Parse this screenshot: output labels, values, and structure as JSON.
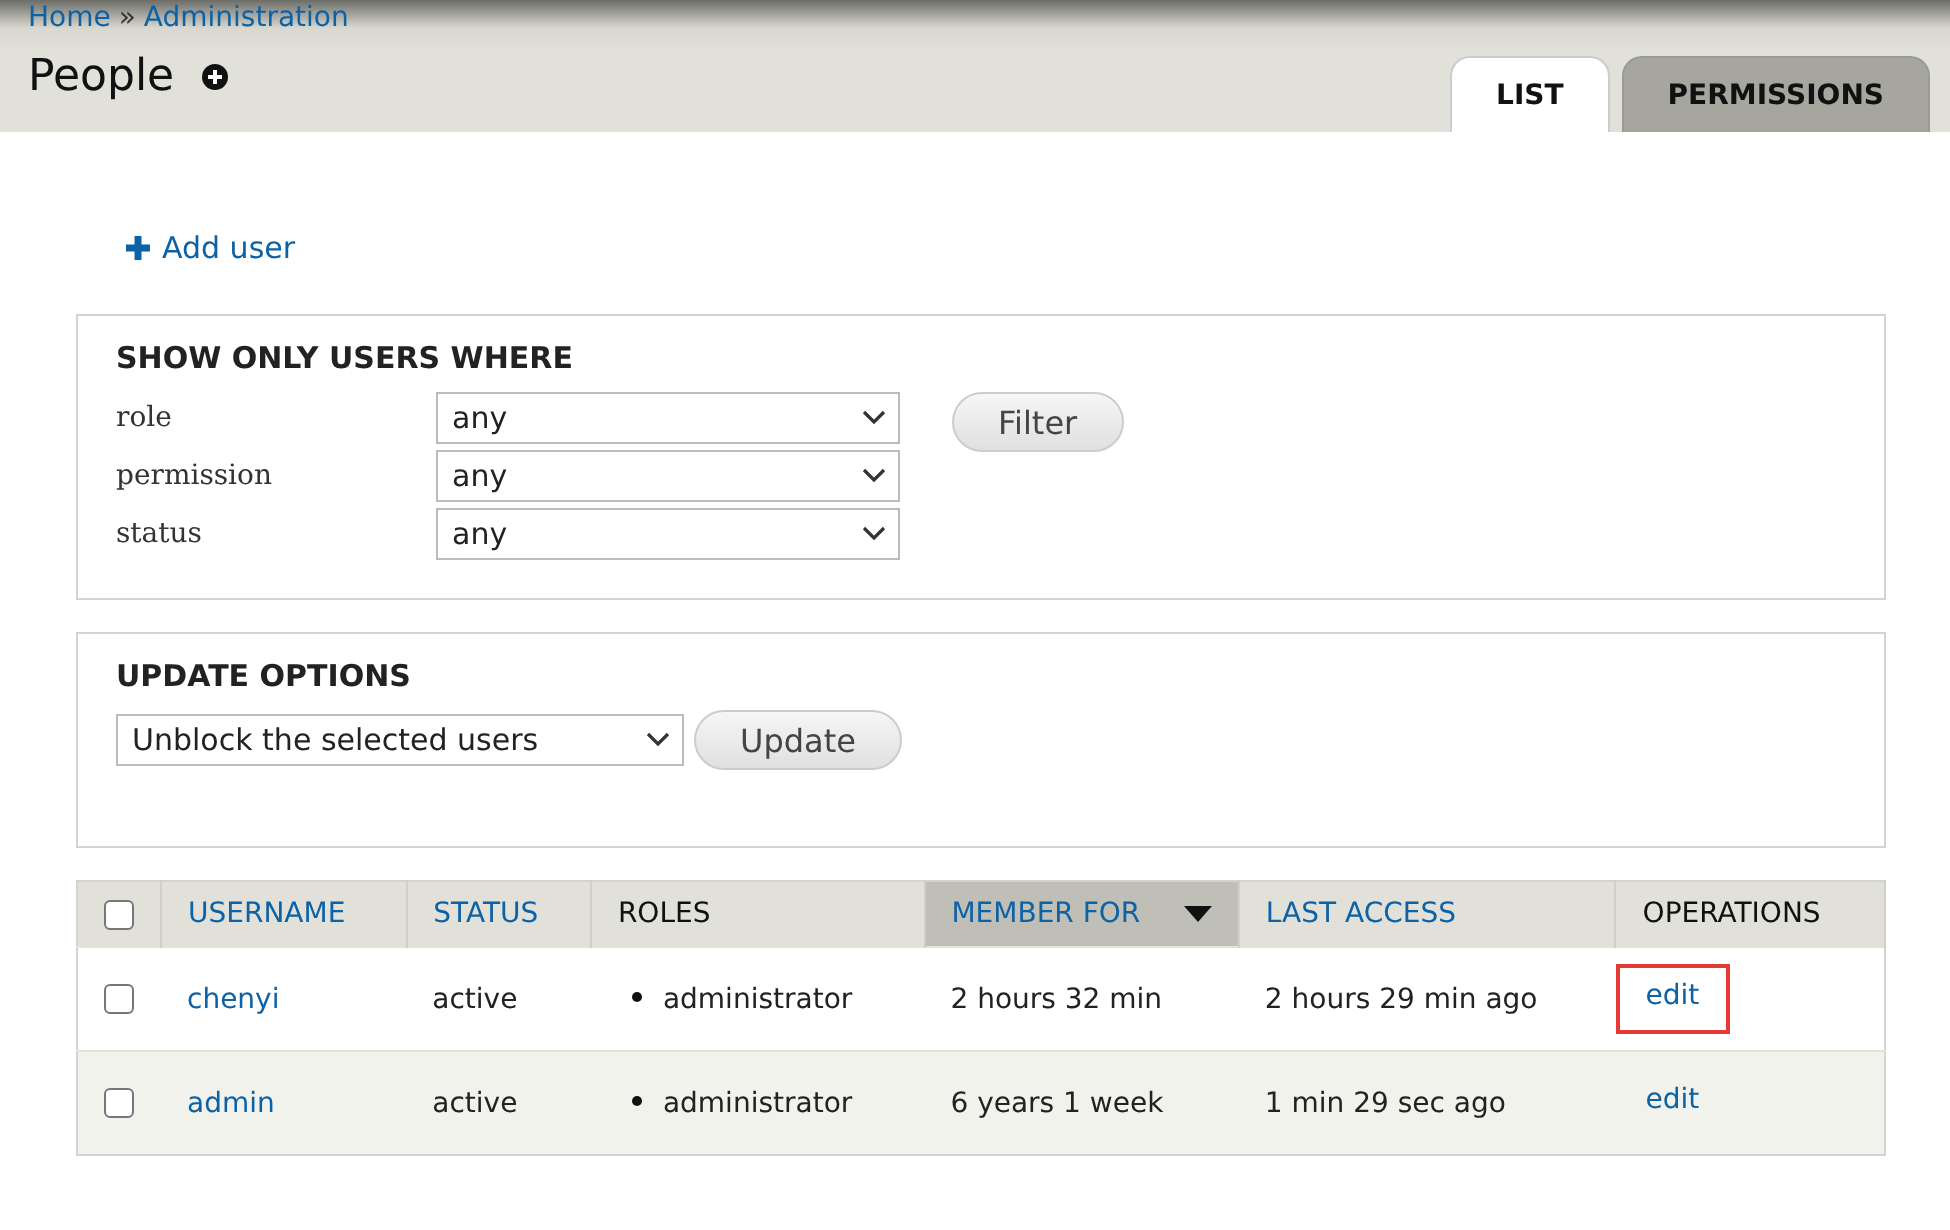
{
  "breadcrumb": [
    "Home",
    "Administration"
  ],
  "breadcrumb_separator": "»",
  "title": "People",
  "tabs": [
    {
      "label": "LIST",
      "selected": true
    },
    {
      "label": "PERMISSIONS",
      "selected": false
    }
  ],
  "action_link": "Add user",
  "filter": {
    "legend": "SHOW ONLY USERS WHERE",
    "fields": [
      {
        "label": "role",
        "value": "any"
      },
      {
        "label": "permission",
        "value": "any"
      },
      {
        "label": "status",
        "value": "any"
      }
    ],
    "button": "Filter"
  },
  "update": {
    "legend": "UPDATE OPTIONS",
    "value": "Unblock the selected users",
    "button": "Update"
  },
  "table": {
    "columns": [
      {
        "label": "USERNAME",
        "sortable": true,
        "sorted": false
      },
      {
        "label": "STATUS",
        "sortable": true,
        "sorted": false
      },
      {
        "label": "ROLES",
        "sortable": false,
        "sorted": false
      },
      {
        "label": "MEMBER FOR",
        "sortable": true,
        "sorted": true
      },
      {
        "label": "LAST ACCESS",
        "sortable": true,
        "sorted": false
      },
      {
        "label": "OPERATIONS",
        "sortable": false,
        "sorted": false
      }
    ],
    "select_all_checked": false,
    "rows": [
      {
        "checked": false,
        "username": "chenyi",
        "status": "active",
        "roles": [
          "administrator"
        ],
        "member_for": "2 hours 32 min",
        "last_access": "2 hours 29 min ago",
        "operation": "edit",
        "highlighted": true
      },
      {
        "checked": false,
        "username": "admin",
        "status": "active",
        "roles": [
          "administrator"
        ],
        "member_for": "6 years 1 week",
        "last_access": "1 min 29 sec ago",
        "operation": "edit",
        "highlighted": false
      }
    ]
  }
}
